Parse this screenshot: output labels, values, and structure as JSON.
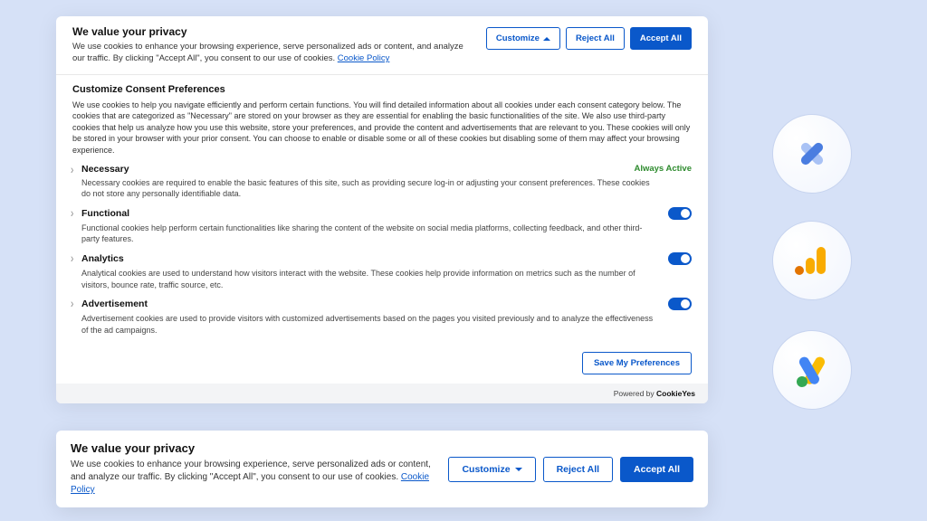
{
  "top": {
    "title": "We value your privacy",
    "desc": "We use cookies to enhance your browsing experience, serve personalized ads or content, and analyze our traffic. By clicking \"Accept All\", you consent to our use of cookies. ",
    "link": "Cookie Policy",
    "customize": "Customize",
    "reject": "Reject All",
    "accept": "Accept All"
  },
  "customize": {
    "title": "Customize Consent Preferences",
    "desc": "We use cookies to help you navigate efficiently and perform certain functions. You will find detailed information about all cookies under each consent category below. The cookies that are categorized as \"Necessary\" are stored on your browser as they are essential for enabling the basic functionalities of the site. We also use third-party cookies that help us analyze how you use this website, store your preferences, and provide the content and advertisements that are relevant to you. These cookies will only be stored in your browser with your prior consent. You can choose to enable or disable some or all of these cookies but disabling some of them may affect your browsing experience."
  },
  "cats": {
    "necessary": {
      "name": "Necessary",
      "badge": "Always Active",
      "desc": "Necessary cookies are required to enable the basic features of this site, such as providing secure log-in or adjusting your consent preferences. These cookies do not store any personally identifiable data."
    },
    "functional": {
      "name": "Functional",
      "desc": "Functional cookies help perform certain functionalities like sharing the content of the website on social media platforms, collecting feedback, and other third-party features."
    },
    "analytics": {
      "name": "Analytics",
      "desc": "Analytical cookies are used to understand how visitors interact with the website. These cookies help provide information on metrics such as the number of visitors, bounce rate, traffic source, etc."
    },
    "advertisement": {
      "name": "Advertisement",
      "desc": "Advertisement cookies are used to provide visitors with customized advertisements based on the pages you visited previously and to analyze the effectiveness of the ad campaigns."
    }
  },
  "save": "Save My Preferences",
  "powered": {
    "prefix": "Powered by ",
    "brand": "CookieYes"
  },
  "bottom": {
    "title": "We value your privacy",
    "desc": "We use cookies to enhance your browsing experience, serve personalized ads or content, and analyze our traffic. By clicking \"Accept All\", you consent to our use of cookies. ",
    "link": "Cookie Policy",
    "customize": "Customize",
    "reject": "Reject All",
    "accept": "Accept All"
  }
}
